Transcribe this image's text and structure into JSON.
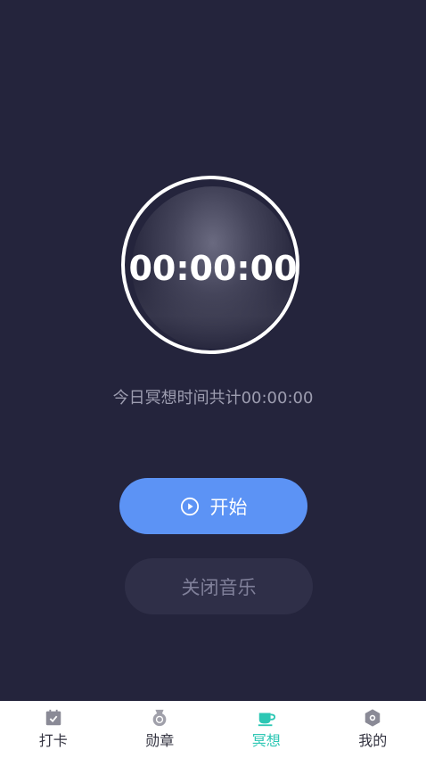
{
  "timer": {
    "display": "00:00:00"
  },
  "summary": {
    "today_text": "今日冥想时间共计00:00:00"
  },
  "controls": {
    "start_label": "开始",
    "music_label": "关闭音乐"
  },
  "tabbar": {
    "active_color": "#2cc7b4",
    "items": [
      {
        "label": "打卡",
        "icon": "calendar-check-icon"
      },
      {
        "label": "勋章",
        "icon": "medal-icon"
      },
      {
        "label": "冥想",
        "icon": "tea-cup-icon",
        "active": true
      },
      {
        "label": "我的",
        "icon": "hexagon-settings-icon"
      }
    ]
  },
  "colors": {
    "background": "#24243c",
    "primary_button": "#5c93f5",
    "secondary_button": "#2f2f48"
  }
}
